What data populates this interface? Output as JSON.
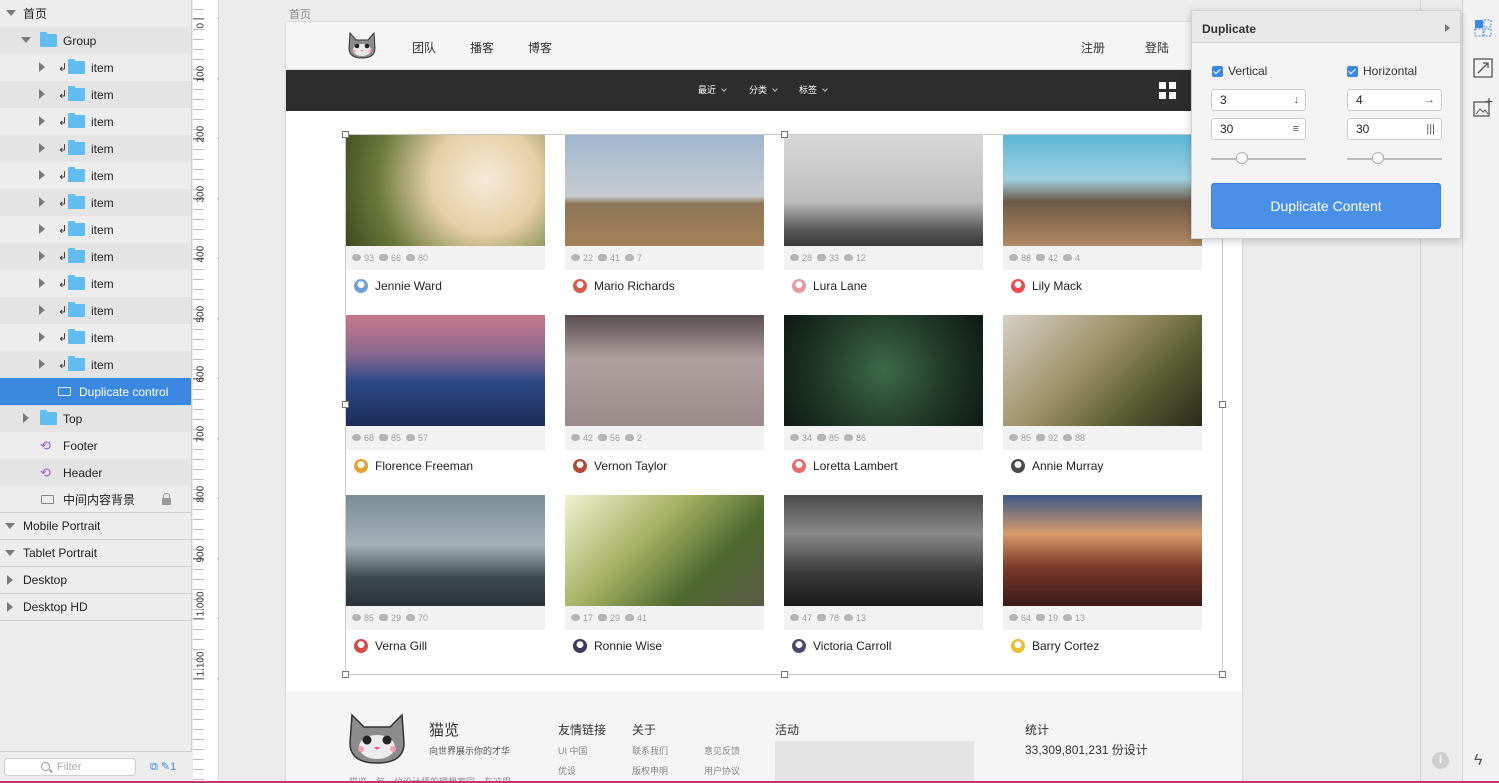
{
  "layers": {
    "page": "首页",
    "group": "Group",
    "items": [
      "item",
      "item",
      "item",
      "item",
      "item",
      "item",
      "item",
      "item",
      "item",
      "item",
      "item",
      "item"
    ],
    "dup_control": "Duplicate control",
    "top": "Top",
    "footer": "Footer",
    "header": "Header",
    "bg": "中间内容背景",
    "pages": [
      "Mobile Portrait",
      "Tablet Portrait",
      "Desktop",
      "Desktop HD"
    ],
    "filter_placeholder": "Filter",
    "filter_count": "1"
  },
  "ruler": {
    "marks": [
      "0",
      "100",
      "200",
      "300",
      "400",
      "500",
      "600",
      "700",
      "800",
      "900",
      "1,000",
      "1,100"
    ]
  },
  "artboard_label": "首页",
  "nav": {
    "links_left": [
      "团队",
      "播客",
      "博客"
    ],
    "links_right": [
      "注册",
      "登陆"
    ]
  },
  "filters": [
    "最近",
    "分类",
    "标签"
  ],
  "cards": [
    {
      "name": "Jennie Ward",
      "views": "93",
      "comments": "66",
      "likes": "80"
    },
    {
      "name": "Mario Richards",
      "views": "22",
      "comments": "41",
      "likes": "7"
    },
    {
      "name": "Lura Lane",
      "views": "28",
      "comments": "33",
      "likes": "12"
    },
    {
      "name": "Lily Mack",
      "views": "88",
      "comments": "42",
      "likes": "4"
    },
    {
      "name": "Florence Freeman",
      "views": "68",
      "comments": "85",
      "likes": "57"
    },
    {
      "name": "Vernon Taylor",
      "views": "42",
      "comments": "56",
      "likes": "2"
    },
    {
      "name": "Loretta Lambert",
      "views": "34",
      "comments": "85",
      "likes": "86"
    },
    {
      "name": "Annie Murray",
      "views": "85",
      "comments": "92",
      "likes": "88"
    },
    {
      "name": "Verna Gill",
      "views": "85",
      "comments": "29",
      "likes": "70"
    },
    {
      "name": "Ronnie Wise",
      "views": "17",
      "comments": "29",
      "likes": "41"
    },
    {
      "name": "Victoria Carroll",
      "views": "47",
      "comments": "78",
      "likes": "13"
    },
    {
      "name": "Barry Cortez",
      "views": "64",
      "comments": "19",
      "likes": "13"
    }
  ],
  "footer": {
    "brand": "猫览",
    "tagline": "向世界展示你的才华",
    "blurb": "猫览，每一位设计师的理想家园，在这里",
    "links_title": "友情链接",
    "links": [
      "UI 中国",
      "优设"
    ],
    "about_title": "关于",
    "about_col1": [
      "联系我们",
      "版权申明"
    ],
    "about_col2": [
      "意见反馈",
      "用户协议"
    ],
    "activity_title": "活动",
    "stats_title": "统计",
    "stats_value": "33,309,801,231 份设计"
  },
  "duplicate": {
    "title": "Duplicate",
    "vertical_label": "Vertical",
    "horizontal_label": "Horizontal",
    "vertical_count": "3",
    "horizontal_count": "4",
    "vertical_spacing": "30",
    "horizontal_spacing": "30",
    "button": "Duplicate Content"
  },
  "colors": {
    "accent": "#3b88e0",
    "button": "#4a90e8",
    "nav_dark": "#2d2d2d"
  }
}
